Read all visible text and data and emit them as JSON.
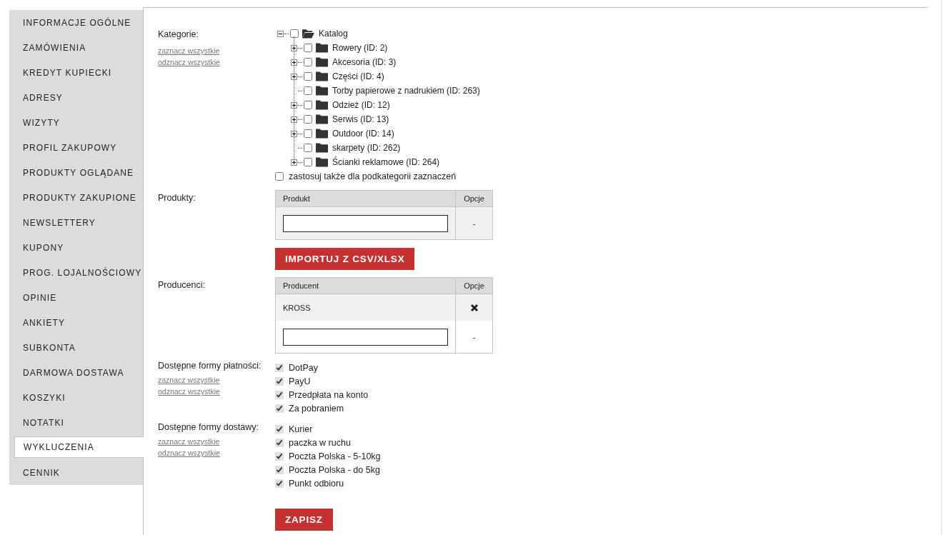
{
  "sidebar": {
    "items": [
      {
        "label": "INFORMACJE OGÓLNE",
        "selected": false
      },
      {
        "label": "ZAMÓWIENIA",
        "selected": false
      },
      {
        "label": "KREDYT KUPIECKI",
        "selected": false
      },
      {
        "label": "ADRESY",
        "selected": false
      },
      {
        "label": "WIZYTY",
        "selected": false
      },
      {
        "label": "PROFIL ZAKUPOWY",
        "selected": false
      },
      {
        "label": "PRODUKTY OGLĄDANE",
        "selected": false
      },
      {
        "label": "PRODUKTY ZAKUPIONE",
        "selected": false
      },
      {
        "label": "NEWSLETTERY",
        "selected": false
      },
      {
        "label": "KUPONY",
        "selected": false
      },
      {
        "label": "PROG. LOJALNOŚCIOWY",
        "selected": false
      },
      {
        "label": "OPINIE",
        "selected": false
      },
      {
        "label": "ANKIETY",
        "selected": false
      },
      {
        "label": "SUBKONTA",
        "selected": false
      },
      {
        "label": "DARMOWA DOSTAWA",
        "selected": false
      },
      {
        "label": "KOSZYKI",
        "selected": false
      },
      {
        "label": "NOTATKI",
        "selected": false
      },
      {
        "label": "WYKLUCZENIA",
        "selected": true
      },
      {
        "label": "CENNIK",
        "selected": false
      }
    ]
  },
  "categories": {
    "label": "Kategorie:",
    "select_all": "zaznacz wszystkie",
    "deselect_all": "odznacz wszystkie",
    "tree": {
      "label": "Katalog",
      "expanded": true,
      "checked": false,
      "children": [
        {
          "label": "Rowery (ID: 2)",
          "expandable": true,
          "checked": false
        },
        {
          "label": "Akcesoria (ID: 3)",
          "expandable": true,
          "checked": false
        },
        {
          "label": "Części (ID: 4)",
          "expandable": true,
          "checked": false
        },
        {
          "label": "Torby papierowe z nadrukiem (ID: 263)",
          "expandable": false,
          "checked": false
        },
        {
          "label": "Odzież (ID: 12)",
          "expandable": true,
          "checked": false
        },
        {
          "label": "Serwis (ID: 13)",
          "expandable": true,
          "checked": false
        },
        {
          "label": "Outdoor (ID: 14)",
          "expandable": true,
          "checked": false
        },
        {
          "label": "skarpety (ID: 262)",
          "expandable": false,
          "checked": false
        },
        {
          "label": "Ścianki reklamowe (ID: 264)",
          "expandable": true,
          "checked": false
        }
      ]
    },
    "apply_subcategories": {
      "label": "zastosuj także dla podkategorii zaznaczeń",
      "checked": false
    }
  },
  "products": {
    "label": "Produkty:",
    "columns": [
      "Produkt",
      "Opcje"
    ],
    "new_row_option": "-"
  },
  "import_button": "IMPORTUJ Z CSV/XLSX",
  "producers": {
    "label": "Producenci:",
    "columns": [
      "Producent",
      "Opcje"
    ],
    "rows": [
      {
        "name": "KROSS"
      }
    ],
    "new_row_option": "-"
  },
  "payment": {
    "label": "Dostępne formy płatności:",
    "select_all": "zaznacz wszystkie",
    "deselect_all": "odznacz wszystkie",
    "options": [
      {
        "label": "DotPay",
        "checked": true
      },
      {
        "label": "PayU",
        "checked": true
      },
      {
        "label": "Przedpłata na konto",
        "checked": true
      },
      {
        "label": "Za pobraniem",
        "checked": true
      }
    ]
  },
  "delivery": {
    "label": "Dostępne formy dostawy:",
    "select_all": "zaznacz wszystkie",
    "deselect_all": "odznacz wszystkie",
    "options": [
      {
        "label": "Kurier",
        "checked": true
      },
      {
        "label": "paczka w ruchu",
        "checked": true
      },
      {
        "label": "Poczta Polska - 5-10kg",
        "checked": true
      },
      {
        "label": "Poczta Polska - do 5kg",
        "checked": true
      },
      {
        "label": "Punkt odbioru",
        "checked": true
      }
    ]
  },
  "save_button": "ZAPISZ"
}
